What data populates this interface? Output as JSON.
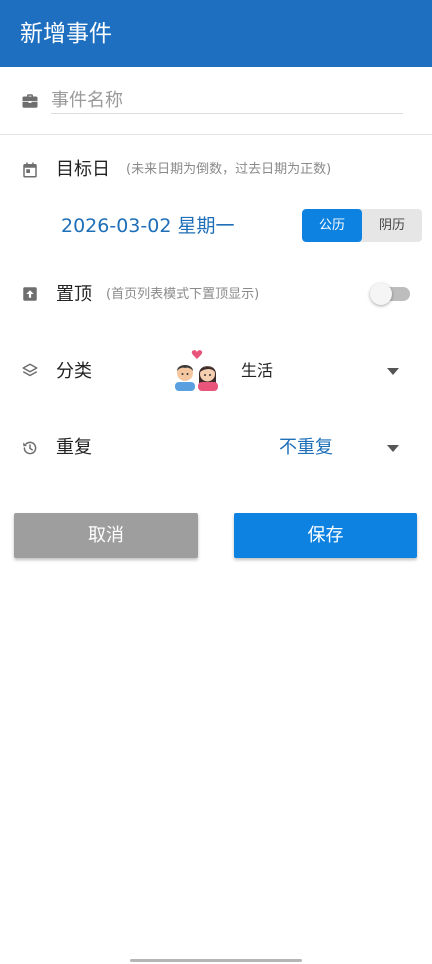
{
  "app_bar": {
    "title": "新增事件"
  },
  "event_name": {
    "placeholder": "事件名称",
    "value": ""
  },
  "target_date": {
    "label": "目标日",
    "hint": "(未来日期为倒数，过去日期为正数)",
    "value": "2026-03-02 星期一",
    "calendar_options": [
      "公历",
      "阴历"
    ],
    "selected_calendar": "公历"
  },
  "pin_top": {
    "label": "置顶",
    "hint": "(首页列表模式下置顶显示)",
    "enabled": false
  },
  "category": {
    "label": "分类",
    "icon": "couple-emoji-icon",
    "value": "生活"
  },
  "repeat": {
    "label": "重复",
    "value": "不重复"
  },
  "actions": {
    "cancel_label": "取消",
    "save_label": "保存"
  },
  "colors": {
    "app_bar": "#1e6fc0",
    "accent": "#0d82e0",
    "value_text": "#1e6fb8",
    "cancel_button": "#9e9e9e"
  }
}
